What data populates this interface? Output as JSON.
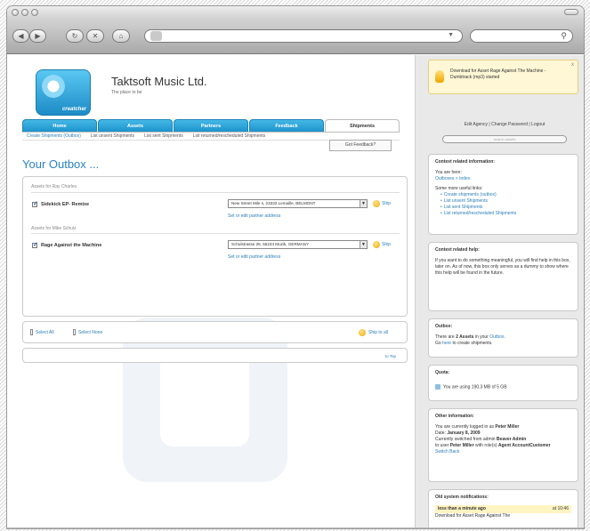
{
  "browser": {
    "address_value": "",
    "search_value": "",
    "buttons": {
      "back": "◀",
      "forward": "▶",
      "reload": "↻",
      "stop": "✕",
      "home": "⌂"
    }
  },
  "header": {
    "company": "Taktsoft Music Ltd.",
    "tagline": "The place to be",
    "logo_word": "creatcher"
  },
  "tabs": [
    {
      "label": "Home",
      "active": false
    },
    {
      "label": "Assets",
      "active": false
    },
    {
      "label": "Partners",
      "active": false
    },
    {
      "label": "Feedback",
      "active": false
    },
    {
      "label": "Shipments",
      "active": true
    }
  ],
  "subnav": [
    {
      "label": "Create Shipments (Outbox)",
      "current": true
    },
    {
      "label": "List unsent Shipments",
      "current": false
    },
    {
      "label": "List sent Shipments",
      "current": false
    },
    {
      "label": "List returned/rescheduled Shipments",
      "current": false
    }
  ],
  "feedback_popup": "Got Feedback?",
  "page_title": "Your Outbox ...",
  "asset_groups": [
    {
      "heading": "Assets for Ray Charles",
      "asset": "Sidekick EP- Remixe",
      "address": "New Street Mile s, 23332 Lemaille, BELMONT",
      "ship_label": "Ship",
      "edit_label": "Set or edit partner address"
    },
    {
      "heading": "Assets for Mike Schulz",
      "asset": "Rage Against the Machine",
      "address": "Schulstrasse 26, 55234 Muzik, GERMANY",
      "ship_label": "Ship",
      "edit_label": "Set or edit partner address"
    }
  ],
  "actions": {
    "select_all": "Select All",
    "select_none": "Select None",
    "ship_all": "Ship to all",
    "to_top": "to Top"
  },
  "sidebar": {
    "notice": {
      "text": "Download for Asset Rage Against The Machine - Dumbtrack (mp3) started",
      "close": "x"
    },
    "user_links": "Edit Agency | Change Password | Logout",
    "search_placeholder": "search assets",
    "context_info": {
      "title": "Context related information:",
      "you_are_here_label": "You are here:",
      "breadcrumb": "Outboxes > Index",
      "useful_links_label": "Some more useful links:",
      "links": [
        "Create shipments (outbox)",
        "List unsent Shipments",
        "List sent Shipments",
        "List returned/rescheduled Shipments"
      ]
    },
    "context_help": {
      "title": "Context related help:",
      "text": "If you want to do something meaningful, you will find help in this box, later on. As of now, this box only serves as a dummy to show where this help will be found in the future."
    },
    "outbox": {
      "title": "Outbox:",
      "text_prefix": "There are",
      "count": "2 Assets",
      "text_mid": "in your",
      "outbox_link": "Outbox",
      "go_prefix": "Go",
      "here_link": "here",
      "go_suffix": "to create shipments."
    },
    "quota": {
      "title": "Quota:",
      "text": "You are using 190.3 MB of 5 GB"
    },
    "other_info": {
      "title": "Other information:",
      "line1_prefix": "You are currently logged in as",
      "user": "Peter Miller",
      "line2_prefix": "Date:",
      "date": "January 8, 2009",
      "line3_prefix": "Currently switched from admin",
      "admin": "Beaver Admin",
      "line4_prefix": "to user",
      "user2": "Peter Miller",
      "line4_mid": "with role(s)",
      "role": "Agent AccountCustomer",
      "switch_back": "Switch Back"
    },
    "old_notifications": {
      "title": "Old system notifications:",
      "item_age": "less than a minute ago",
      "item_time": "at 10:46",
      "item_text": "Download for Asset Rage Against The"
    }
  }
}
